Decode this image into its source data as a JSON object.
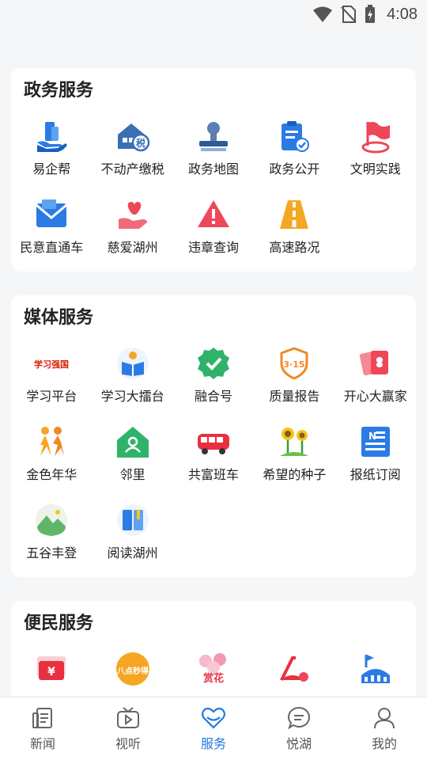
{
  "status": {
    "time": "4:08"
  },
  "sections": {
    "gov": {
      "title": "政务服务",
      "items": [
        "易企帮",
        "不动产缴税",
        "政务地图",
        "政务公开",
        "文明实践",
        "民意直通车",
        "慈爱湖州",
        "违章查询",
        "高速路况"
      ]
    },
    "media": {
      "title": "媒体服务",
      "items": [
        "学习平台",
        "学习大擂台",
        "融合号",
        "质量报告",
        "开心大赢家",
        "金色年华",
        "邻里",
        "共富班车",
        "希望的种子",
        "报纸订阅",
        "五谷丰登",
        "阅读湖州"
      ],
      "icon_texts": {
        "xuexi": "学习强国",
        "quality": "3·15"
      }
    },
    "conv": {
      "title": "便民服务",
      "icon_texts": {
        "coupon": "¥",
        "sale": "八点秒得",
        "flower": "赏花"
      }
    }
  },
  "tabs": [
    "新闻",
    "视听",
    "服务",
    "悦湖",
    "我的"
  ],
  "active_tab": 2,
  "colors": {
    "accent": "#1f7ae0",
    "blue_icon": "#2b7be5",
    "red_icon": "#f0465a",
    "yellow_icon": "#f5a623",
    "green_icon": "#2fb36b"
  }
}
